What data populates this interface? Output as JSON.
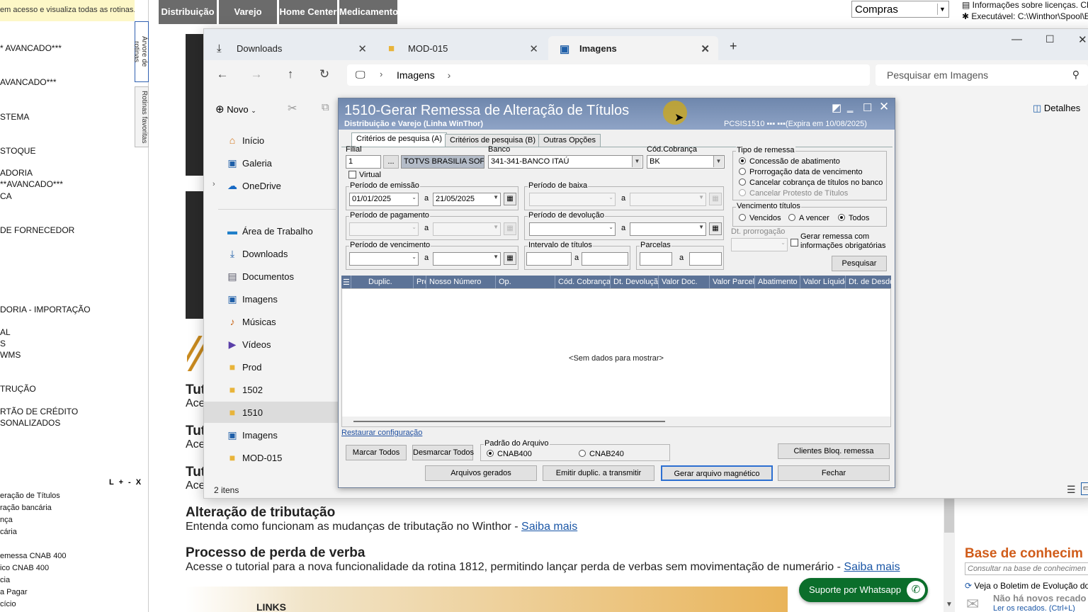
{
  "left_menu": {
    "banner": "em acesso e visualiza todas as rotinas.",
    "items": [
      "* AVANCADO***",
      "AVANCADO***",
      "STEMA",
      "STOQUE",
      "ADORIA",
      "**AVANCADO***",
      "CA",
      "DE FORNECEDOR",
      "DORIA - IMPORTAÇÃO",
      "AL",
      "S",
      "WMS",
      "TRUÇÃO",
      "RTÃO DE CRÉDITO",
      "SONALIZADOS"
    ],
    "zoom_controls": "L + - X",
    "bottom_items": [
      "eração de Títulos",
      "ração bancária",
      "nça",
      "cária",
      "emessa CNAB 400",
      "ico CNAB 400",
      "cia",
      "a Pagar",
      "cício"
    ],
    "vtab_tree": "Árvore de rotinas",
    "vtab_fav": "Rotinas favoritas"
  },
  "top_bar": {
    "buttons": [
      "Distribuição",
      "Varejo",
      "Home Center",
      "Medicamento"
    ],
    "select_value": "Compras",
    "info_license": "Informações sobre licenças. Clique",
    "info_exec": "Executável: C:\\Winthor\\Spool\\Ex"
  },
  "background_page": {
    "tut_items": [
      {
        "title": "Tut",
        "text": "Ace"
      },
      {
        "title": "Tut",
        "text": "Ace"
      },
      {
        "title": "Tut",
        "text": "Ace"
      }
    ],
    "news": [
      {
        "title": "Alteração de tributação",
        "text": "Entenda como funcionam as mudanças de tributação no Winthor - ",
        "link": "Saiba mais"
      },
      {
        "title": "Processo de perda de verba",
        "text": "Acesse o tutorial para a nova funcionalidade da rotina 1812, permitindo lançar perda de verbas sem movimentação de numerário - ",
        "link": "Saiba mais"
      }
    ],
    "links_title": "LINKS",
    "kb_title": "Base de conhecim",
    "kb_search_placeholder": "Consultar na base de conhecimen",
    "kb_item": "Veja o Boletim de Evolução do V",
    "msg_title": "Não há novos recado",
    "msg_link": "Ler os recados. (Ctrl+L)",
    "whatsapp": "Suporte por Whatsapp"
  },
  "explorer": {
    "tabs": [
      {
        "label": "Downloads",
        "icon": "download-icon"
      },
      {
        "label": "MOD-015",
        "icon": "folder-icon"
      },
      {
        "label": "Imagens",
        "icon": "image-icon"
      }
    ],
    "new_tab": "+",
    "address_segment": "Imagens",
    "search_placeholder": "Pesquisar em Imagens",
    "new_button": "Novo",
    "details_button": "Detalhes",
    "sidebar": [
      {
        "label": "Início",
        "icon": "home-icon"
      },
      {
        "label": "Galeria",
        "icon": "gallery-icon"
      },
      {
        "label": "OneDrive",
        "icon": "cloud-icon"
      },
      {
        "label": "Área de Trabalho",
        "icon": "desktop-icon"
      },
      {
        "label": "Downloads",
        "icon": "download-icon"
      },
      {
        "label": "Documentos",
        "icon": "document-icon"
      },
      {
        "label": "Imagens",
        "icon": "image-icon"
      },
      {
        "label": "Músicas",
        "icon": "music-icon"
      },
      {
        "label": "Vídeos",
        "icon": "video-icon"
      },
      {
        "label": "Prod",
        "icon": "folder-icon"
      },
      {
        "label": "1502",
        "icon": "folder-icon"
      },
      {
        "label": "1510",
        "icon": "folder-icon"
      },
      {
        "label": "Imagens",
        "icon": "image-icon"
      },
      {
        "label": "MOD-015",
        "icon": "folder-icon"
      }
    ],
    "status": "2 itens"
  },
  "dialog": {
    "title": "1510-Gerar Remessa de Alteração de Títulos",
    "subtitle": "Distribuição e Varejo (Linha WinThor)",
    "code": "PCSIS1510   ▪▪▪ ▪▪▪(Expira em 10/08/2025)",
    "tabs": [
      "Critérios de pesquisa (A)",
      "Critérios de pesquisa (B)",
      "Outras Opções"
    ],
    "filial_label": "Filial",
    "filial_value": "1",
    "filial_btn": "...",
    "filial_name": "TOTVS BRASILIA SOFTV",
    "banco_label": "Banco",
    "banco_value": "341-341-BANCO ITAÚ",
    "codcob_label": "Cód.Cobrança",
    "codcob_value": "BK",
    "virtual_label": "Virtual",
    "a": "a",
    "periodo_emissao": "Período de emissão",
    "emissao_de": "01/01/2025",
    "emissao_ate": "21/05/2025",
    "periodo_baixa": "Período de baixa",
    "periodo_pagamento": "Período de pagamento",
    "periodo_devolucao": "Período de devolução",
    "periodo_vencimento": "Período de vencimento",
    "intervalo_titulos": "Intervalo de títulos",
    "parcelas": "Parcelas",
    "tipo_remessa": "Tipo de remessa",
    "tipo_opts": [
      "Concessão de abatimento",
      "Prorrogação data de vencimento",
      "Cancelar cobrança de títulos no banco",
      "Cancelar Protesto de Títulos"
    ],
    "venc_titulos": "Vencimento títulos",
    "venc_opts": [
      "Vencidos",
      "A vencer",
      "Todos"
    ],
    "dt_prorrogacao": "Dt. prorrogação",
    "gerar_remessa_chk": "Gerar remessa com informações obrigatórias",
    "pesquisar": "Pesquisar",
    "grid_cols": [
      "Duplic.",
      "Pre",
      "Nosso Número",
      "Op.",
      "Cód. Cobrança",
      "Dt. Devolução",
      "Valor Doc.",
      "Valor Parcela",
      "Abatimento",
      "Valor Líquido",
      "Dt. de Desdo"
    ],
    "grid_empty": "<Sem dados para mostrar>",
    "restaurar": "Restaurar configuração",
    "marcar_todos": "Marcar Todos",
    "desmarcar_todos": "Desmarcar Todos",
    "padrao_arquivo": "Padrão do Arquivo",
    "cnab400": "CNAB400",
    "cnab240": "CNAB240",
    "clientes_bloq": "Clientes Bloq. remessa",
    "arquivos_gerados": "Arquivos gerados",
    "emitir_duplic": "Emitir duplic. a transmitir",
    "gerar_arquivo": "Gerar arquivo magnético",
    "fechar": "Fechar"
  }
}
